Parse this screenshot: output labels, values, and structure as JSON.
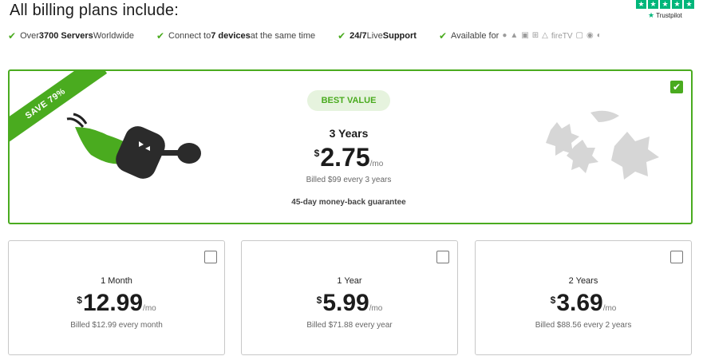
{
  "header": {
    "title": "All billing plans include:",
    "trustpilot_label": "Trustpilot",
    "trustpilot_stars": 5
  },
  "features": [
    {
      "pre": "Over ",
      "bold": "3700 Servers",
      "post": " Worldwide"
    },
    {
      "pre": "Connect to ",
      "bold": "7 devices",
      "post": " at the same time"
    },
    {
      "pre": "",
      "bold": "24/7",
      "post": " Live ",
      "bold2": "Support"
    },
    {
      "pre": "Available for",
      "platforms_text": "fireTV"
    }
  ],
  "best_plan": {
    "ribbon": "SAVE 79%",
    "badge": "BEST VALUE",
    "title": "3 Years",
    "currency": "$",
    "price": "2.75",
    "period": "/mo",
    "billed": "Billed $99 every 3 years",
    "guarantee": "45-day money-back guarantee",
    "selected": true
  },
  "plans": [
    {
      "title": "1 Month",
      "currency": "$",
      "price": "12.99",
      "period": "/mo",
      "billed": "Billed $12.99 every month",
      "selected": false
    },
    {
      "title": "1 Year",
      "currency": "$",
      "price": "5.99",
      "period": "/mo",
      "billed": "Billed $71.88 every year",
      "selected": false
    },
    {
      "title": "2 Years",
      "currency": "$",
      "price": "3.69",
      "period": "/mo",
      "billed": "Billed $88.56 every 2 years",
      "selected": false
    }
  ],
  "colors": {
    "accent": "#4aab1f",
    "badge_bg": "#e6f3de",
    "trustpilot": "#00b67a"
  },
  "icons": [
    "check-icon",
    "apple-icon",
    "android-icon",
    "windows-icon",
    "linux-icon",
    "firetv-icon",
    "router-icon",
    "chrome-icon",
    "firefox-icon",
    "trustpilot-star-icon"
  ]
}
